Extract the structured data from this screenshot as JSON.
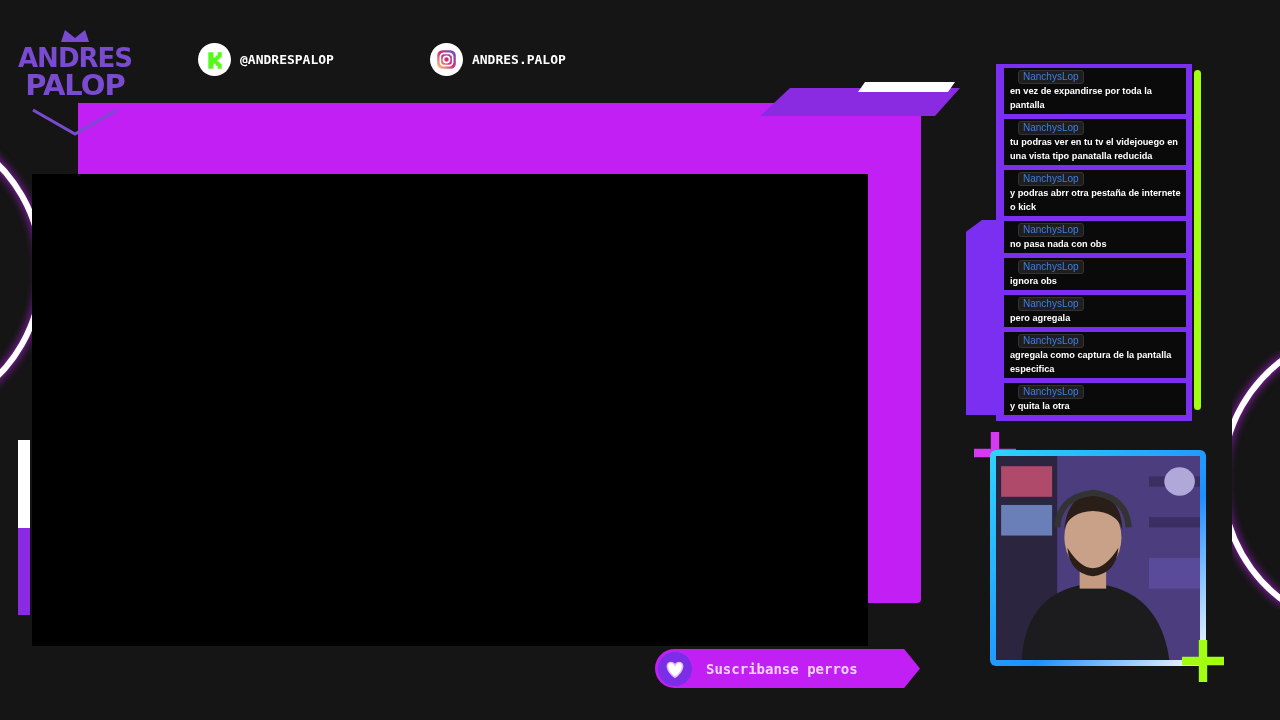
{
  "logo": {
    "line_1": "ANDRES",
    "line_2": "PALOP"
  },
  "socials": [
    {
      "kind": "kick",
      "handle": "@ANDRESPALOP"
    },
    {
      "kind": "instagram",
      "handle": "ANDRES.PALOP"
    }
  ],
  "chat": {
    "messages": [
      {
        "user": "NanchysLop",
        "text": "en vez de expandirse por toda la pantalla"
      },
      {
        "user": "NanchysLop",
        "text": "tu podras ver en tu tv el videjouego en una vista tipo panatalla reducida"
      },
      {
        "user": "NanchysLop",
        "text": "y podras abrr otra pestaña de internete o kick"
      },
      {
        "user": "NanchysLop",
        "text": "no pasa nada con obs"
      },
      {
        "user": "NanchysLop",
        "text": "ignora obs"
      },
      {
        "user": "NanchysLop",
        "text": "pero agregala"
      },
      {
        "user": "NanchysLop",
        "text": "agregala como captura de la pantalla especifica"
      },
      {
        "user": "NanchysLop",
        "text": "y quita la otra"
      }
    ]
  },
  "banner": {
    "text": "Suscribanse perros"
  }
}
